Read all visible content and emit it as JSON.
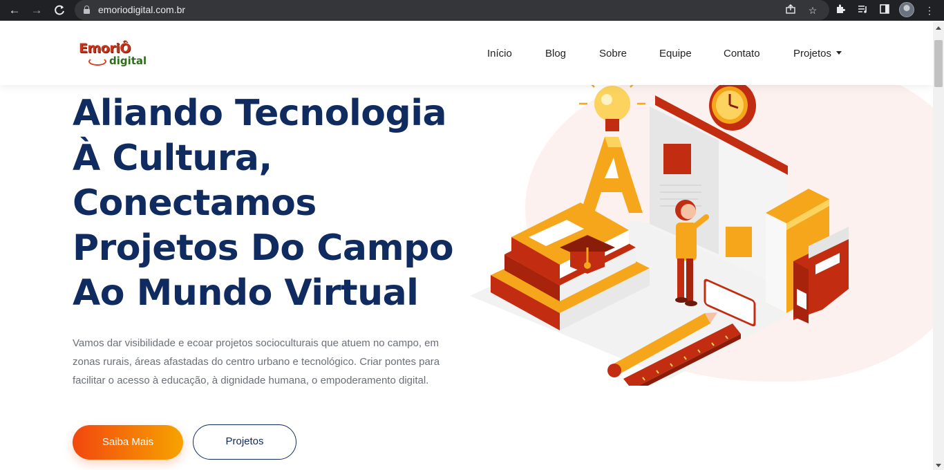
{
  "browser": {
    "url": "emoriodigital.com.br"
  },
  "site": {
    "logo_line1": "EmoriÔ",
    "logo_line2": "digital",
    "nav": [
      {
        "label": "Início"
      },
      {
        "label": "Blog"
      },
      {
        "label": "Sobre"
      },
      {
        "label": "Equipe"
      },
      {
        "label": "Contato"
      },
      {
        "label": "Projetos"
      }
    ]
  },
  "hero": {
    "title_lines": [
      "Aliando Tecnologia",
      "À Cultura,",
      "Conectamos",
      "Projetos Do Campo",
      "Ao Mundo Virtual"
    ],
    "text_lines": [
      "Vamos dar visibilidade e ecoar projetos socioculturais que atuem no campo, em",
      "zonas rurais, áreas afastadas do centro urbano e tecnológico. Criar pontes para",
      "facilitar o acesso à educação, à dignidade humana, o empoderamento digital."
    ],
    "primary_button": "Saiba Mais",
    "secondary_button": "Projetos"
  },
  "colors": {
    "navy": "#0f2b60",
    "orange": "#f2470f",
    "amber": "#f7a300",
    "red": "#c5361b"
  }
}
